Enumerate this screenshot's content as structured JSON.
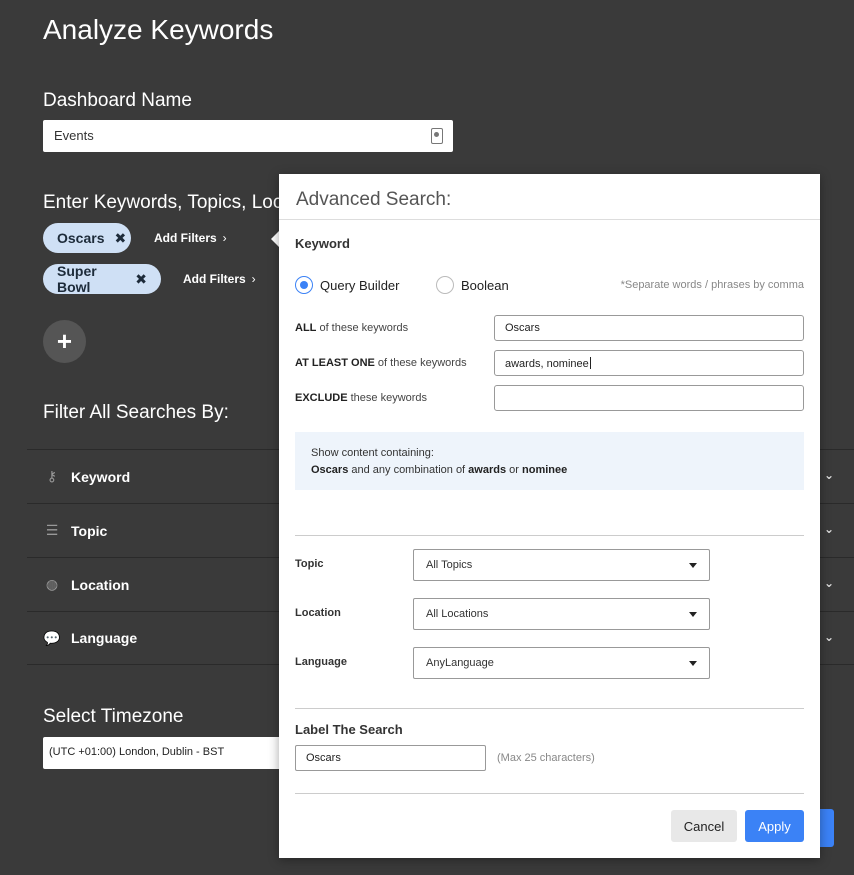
{
  "page": {
    "title": "Analyze Keywords"
  },
  "dashboard": {
    "label": "Dashboard Name",
    "value": "Events"
  },
  "keywords_section": {
    "label": "Enter Keywords, Topics, Loc",
    "searches": [
      {
        "label": "Oscars",
        "add_filters": "Add Filters"
      },
      {
        "label": "Super Bowl",
        "add_filters": "Add Filters"
      }
    ],
    "add_button": "+"
  },
  "filter_all": {
    "label": "Filter All Searches By:",
    "rows": [
      {
        "label": "Keyword",
        "icon": "key-icon"
      },
      {
        "label": "Topic",
        "icon": "list-icon"
      },
      {
        "label": "Location",
        "icon": "globe-icon"
      },
      {
        "label": "Language",
        "icon": "chat-icon"
      }
    ]
  },
  "timezone": {
    "label": "Select Timezone",
    "value": "(UTC +01:00) London, Dublin - BST"
  },
  "modal": {
    "title": "Advanced Search:",
    "keyword_heading": "Keyword",
    "modes": [
      {
        "label": "Query Builder",
        "checked": true
      },
      {
        "label": "Boolean",
        "checked": false
      }
    ],
    "separator_hint": "*Separate words / phrases by comma",
    "fields": {
      "all": {
        "bold": "ALL",
        "rest": " of these keywords",
        "value": "Oscars"
      },
      "at_least_one": {
        "bold": "AT LEAST ONE",
        "rest": " of these keywords",
        "value": "awards, nominee"
      },
      "exclude": {
        "bold": "EXCLUDE",
        "rest": " these keywords",
        "value": ""
      }
    },
    "preview": {
      "line1": "Show content containing:",
      "term1": "Oscars",
      "text1": " and any combination of ",
      "term2": "awards",
      "text2": " or ",
      "term3": "nominee"
    },
    "selects": [
      {
        "label": "Topic",
        "value": "All Topics"
      },
      {
        "label": "Location",
        "value": "All Locations"
      },
      {
        "label": "Language",
        "value": "AnyLanguage"
      }
    ],
    "label_search": {
      "heading": "Label The Search",
      "value": "Oscars",
      "hint": "(Max 25 characters)"
    },
    "buttons": {
      "cancel": "Cancel",
      "apply": "Apply"
    }
  },
  "colors": {
    "background": "#3a3a3a",
    "accent": "#3b82f6",
    "pill": "#cfe0f5",
    "preview_bg": "#eef4fb"
  }
}
